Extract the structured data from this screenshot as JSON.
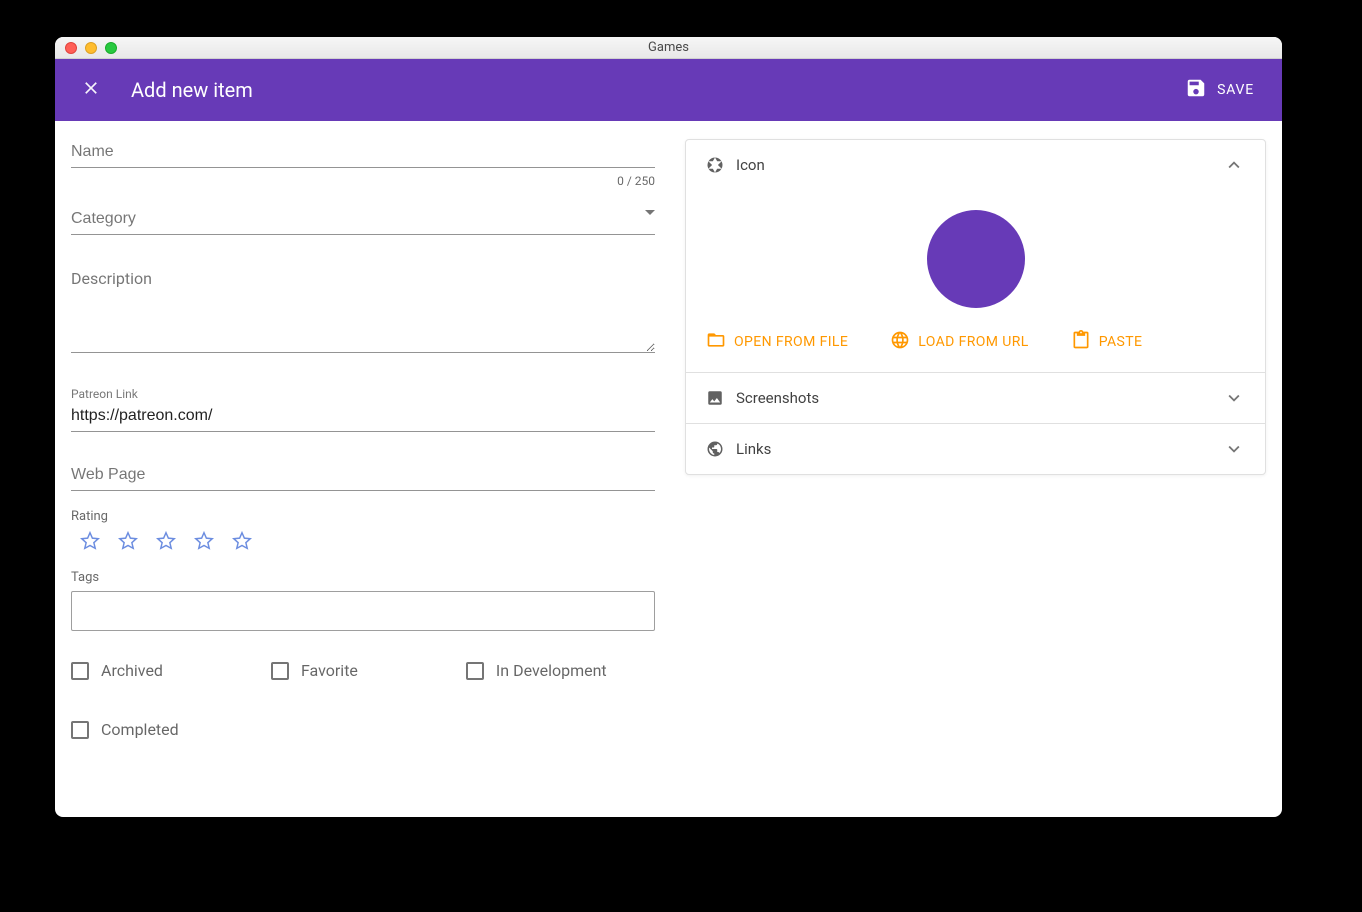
{
  "window": {
    "title": "Games"
  },
  "appbar": {
    "title": "Add new item",
    "save_label": "SAVE"
  },
  "form": {
    "name": {
      "placeholder": "Name",
      "value": "",
      "counter": "0 / 250"
    },
    "category": {
      "placeholder": "Category",
      "value": ""
    },
    "description": {
      "placeholder": "Description",
      "value": ""
    },
    "patreon": {
      "label": "Patreon Link",
      "value": "https://patreon.com/"
    },
    "webpage": {
      "placeholder": "Web Page",
      "value": ""
    },
    "rating": {
      "label": "Rating",
      "value": 0
    },
    "tags": {
      "label": "Tags"
    },
    "checks": {
      "archived": "Archived",
      "favorite": "Favorite",
      "in_development": "In Development",
      "completed": "Completed"
    }
  },
  "panels": {
    "icon": {
      "title": "Icon",
      "open_file": "OPEN FROM FILE",
      "load_url": "LOAD FROM URL",
      "paste": "PASTE"
    },
    "screenshots": {
      "title": "Screenshots"
    },
    "links": {
      "title": "Links"
    }
  },
  "colors": {
    "primary": "#673ab7",
    "accent": "#ff9800"
  }
}
